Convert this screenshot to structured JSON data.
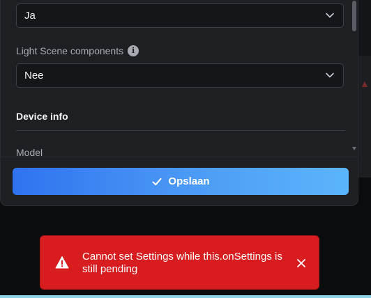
{
  "settings": {
    "select_1": {
      "value": "Ja"
    },
    "light_scene": {
      "label": "Light Scene components",
      "value": "Nee"
    },
    "device_info": {
      "title": "Device info",
      "model_label": "Model"
    },
    "save_button": {
      "label": "Opslaan"
    }
  },
  "toast": {
    "message": "Cannot set Settings while this.onSettings is still pending",
    "icon": "warning-icon",
    "color": "#d71d1f"
  },
  "accent": "#3b8cf2",
  "icons": {
    "chevron": "chevron-down-icon",
    "info": "info-icon",
    "check": "check-icon",
    "close": "close-icon"
  }
}
